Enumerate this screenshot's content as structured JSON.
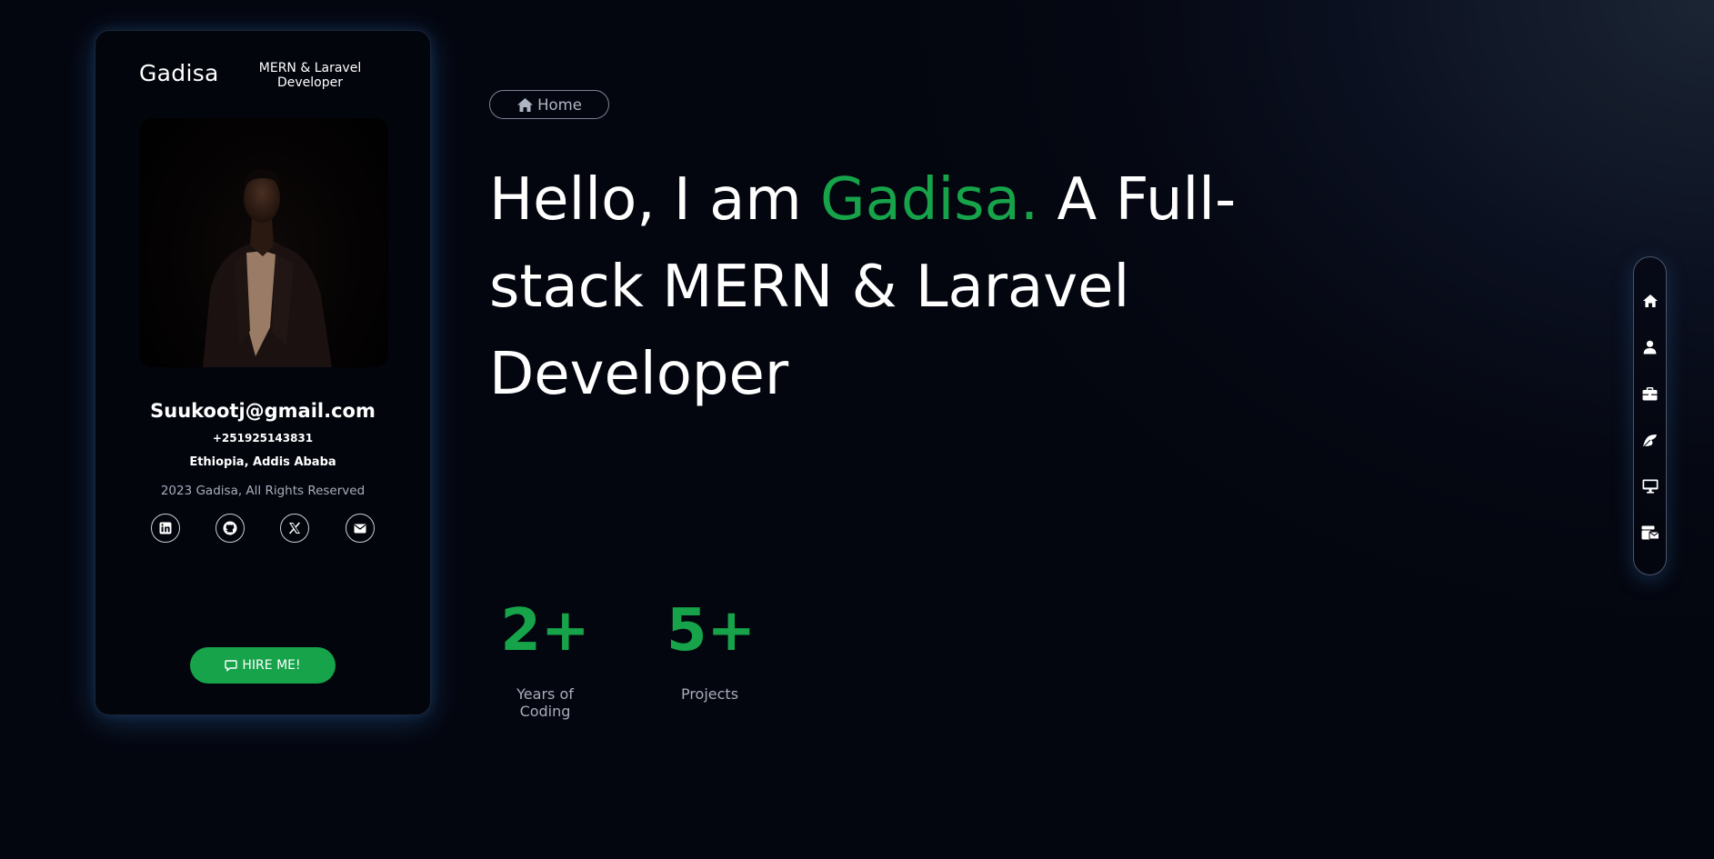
{
  "profile": {
    "name": "Gadisa",
    "role": "MERN & Laravel Developer",
    "email": "Suukootj@gmail.com",
    "phone": "+251925143831",
    "location": "Ethiopia, Addis Ababa",
    "copyright": "2023 Gadisa, All Rights Reserved",
    "social": [
      "linkedin-icon",
      "github-icon",
      "x-twitter-icon",
      "envelope-icon"
    ],
    "hire_label": "HIRE ME!"
  },
  "hero": {
    "badge_label": "Home",
    "headline_intro": "Hello, I am",
    "headline_name": "Gadisa.",
    "headline_rest": "A Full-stack MERN & Laravel Developer",
    "stats": [
      {
        "value": "2+",
        "label": "Years of Coding"
      },
      {
        "value": "5+",
        "label": "Projects"
      }
    ]
  },
  "sidenav": {
    "items": [
      "home-icon",
      "user-icon",
      "briefcase-icon",
      "blog-icon",
      "desktop-icon",
      "contact-icon"
    ]
  },
  "colors": {
    "accent": "#16a34a",
    "background": "#04060f",
    "muted_text": "#a7adbb"
  }
}
